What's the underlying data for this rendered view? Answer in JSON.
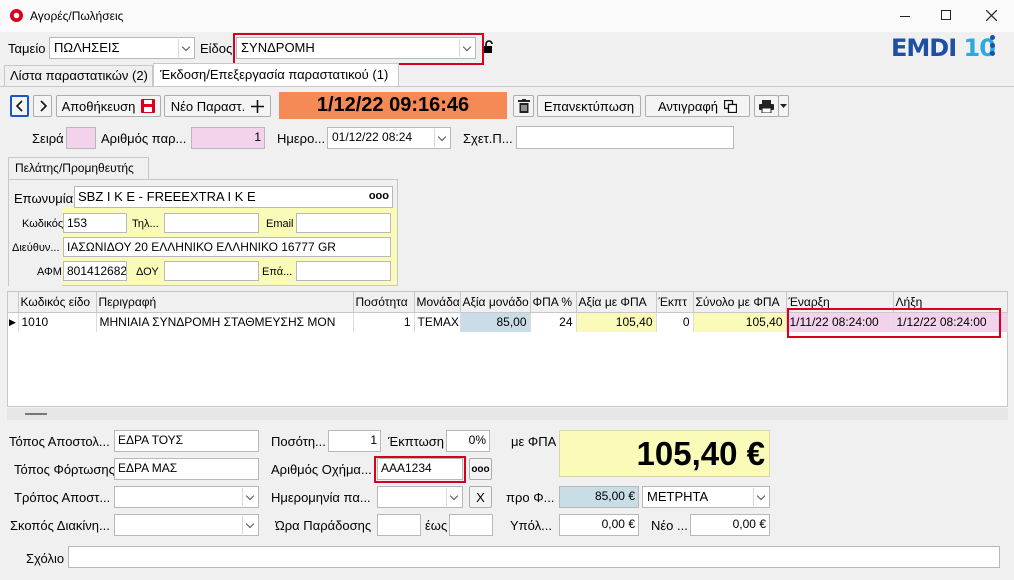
{
  "window": {
    "title": "Αγορές/Πωλήσεις"
  },
  "brand": {
    "logo_text": "EMDI10",
    "accent": "#1d4fa5",
    "cyan": "#2ea9df"
  },
  "colors": {
    "timestamp_bg": "#f58a57",
    "highlight_red": "#d8001c",
    "pink": "#f3d2ec",
    "yellow": "#fbfbb9"
  },
  "top": {
    "cash_label": "Ταμείο",
    "cash_value": "ΠΩΛΗΣΕΙΣ",
    "type_label": "Είδος",
    "type_value": "ΣΥΝΔΡΟΜΗ"
  },
  "tabs": [
    {
      "label": "Λίστα παραστατικών (2)"
    },
    {
      "label": "Έκδοση/Επεξεργασία παραστατικού (1)"
    }
  ],
  "toolbar": {
    "save_label": "Αποθήκευση",
    "new_label": "Νέο Παραστ.",
    "timestamp": "1/12/22 09:16:46",
    "reprint_label": "Επανεκτύπωση",
    "copy_label": "Αντιγραφή"
  },
  "doc": {
    "series_label": "Σειρά",
    "series_value": "",
    "number_label": "Αριθμός παρ...",
    "number_value": "1",
    "date_label": "Ημερο...",
    "date_value": "01/12/22 08:24",
    "related_label": "Σχετ.Π...",
    "related_value": ""
  },
  "customer": {
    "section_label": "Πελάτης/Προμηθευτής",
    "name_label": "Επωνυμία",
    "name_value": "SBZ I K E - FREEEXTRA I K E",
    "more_icon": "ooo",
    "code_label": "Κωδικός",
    "code_value": "153",
    "phone_label": "Τηλ...",
    "phone_value": "",
    "email_label": "Email",
    "email_value": "",
    "address_label": "Διεύθυν...",
    "address_value": "ΙΑΣΩΝΙΔΟΥ 20 ΕΛΛΗΝΙΚΟ ΕΛΛΗΝΙΚΟ 16777 GR",
    "afm_label": "ΑΦΜ",
    "afm_value": "801412682",
    "doy_label": "ΔΟΥ",
    "doy_value": "",
    "prof_label": "Επά...",
    "prof_value": ""
  },
  "grid": {
    "columns": [
      "Κωδικός είδο",
      "Περιγραφή",
      "Ποσότητα",
      "Μονάδα",
      "Αξία μονάδο",
      "ΦΠΑ %",
      "Αξία με ΦΠΑ",
      "Έκπτ",
      "Σύνολο με ΦΠΑ",
      "Έναρξη",
      "Λήξη"
    ],
    "rows": [
      [
        "1010",
        "ΜΗΝΙΑΙΑ ΣΥΝΔΡΟΜΗ ΣΤΑΘΜΕΥΣΗΣ ΜΟΝ",
        "1",
        "ΤΕΜΑΧ",
        "85,00",
        "24",
        "105,40",
        "0",
        "105,40",
        "1/11/22 08:24:00",
        "1/12/22 08:24:00"
      ]
    ]
  },
  "bottom": {
    "dispatch_place_label": "Τόπος Αποστολ...",
    "dispatch_place_value": "ΕΔΡΑ ΤΟΥΣ",
    "loading_place_label": "Τόπος Φόρτωσης",
    "loading_place_value": "ΕΔΡΑ ΜΑΣ",
    "ship_method_label": "Τρόπος Αποστ...",
    "ship_method_value": "",
    "purpose_label": "Σκοπός Διακίνη...",
    "purpose_value": "",
    "qty_label": "Ποσότη...",
    "qty_value": "1",
    "discount_label": "Έκπτωση",
    "discount_value": "0%",
    "vehicle_label": "Αριθμός Οχήμα...",
    "vehicle_value": "AAA1234",
    "delivery_date_label": "Ημερομηνία πα...",
    "delivery_date_value": "",
    "clear_label": "X",
    "delivery_time_label": "Ώρα Παράδοσης",
    "delivery_time_value": "",
    "until_label": "έως",
    "until_value": "",
    "with_vat_label": "με ΦΠΑ",
    "total": "105,40 €",
    "before_vat_label": "προ Φ...",
    "before_vat_value": "85,00 €",
    "payment_value": "ΜΕΤΡΗΤΑ",
    "balance_label": "Υπόλ...",
    "balance_value": "0,00 €",
    "new_label": "Νέο ...",
    "new_value": "0,00 €",
    "comment_label": "Σχόλιο",
    "comment_value": ""
  }
}
